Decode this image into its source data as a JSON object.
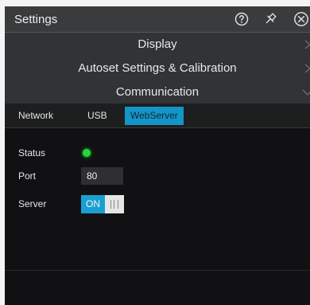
{
  "window": {
    "title": "Settings",
    "help_icon": "help-circle-icon",
    "pin_icon": "pin-icon",
    "close_icon": "close-circle-icon"
  },
  "sections": [
    {
      "label": "Display",
      "expanded": false
    },
    {
      "label": "Autoset Settings & Calibration",
      "expanded": false
    },
    {
      "label": "Communication",
      "expanded": true
    }
  ],
  "communication": {
    "network_label": "Network",
    "tabs": [
      {
        "label": "USB",
        "selected": false
      },
      {
        "label": "WebServer",
        "selected": true
      }
    ],
    "status_label": "Status",
    "status_color": "#22d83a",
    "port_label": "Port",
    "port_value": "80",
    "server_label": "Server",
    "server_toggle_label": "ON",
    "server_on": true
  },
  "colors": {
    "accent": "#1a9fd3",
    "status_ok": "#22d83a"
  }
}
